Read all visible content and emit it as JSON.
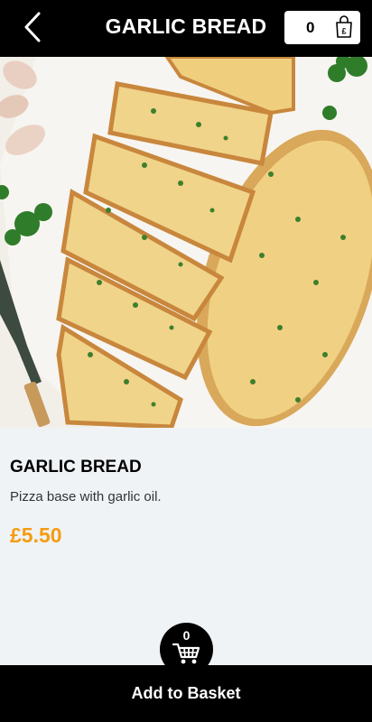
{
  "header": {
    "title": "GARLIC BREAD",
    "basket_count": "0",
    "back_icon": "chevron-left-icon",
    "basket_icon": "shopping-bag-pound-icon"
  },
  "hero": {
    "image": "garlic-bread-photo"
  },
  "product": {
    "name": "GARLIC BREAD",
    "description": "Pizza base with garlic oil.",
    "price": "£5.50"
  },
  "cart_fab": {
    "count": "0",
    "icon": "cart-icon"
  },
  "footer": {
    "add_label": "Add to Basket"
  },
  "colors": {
    "bar": "#000000",
    "page_bg": "#eff3f6",
    "price": "#f59c12"
  }
}
